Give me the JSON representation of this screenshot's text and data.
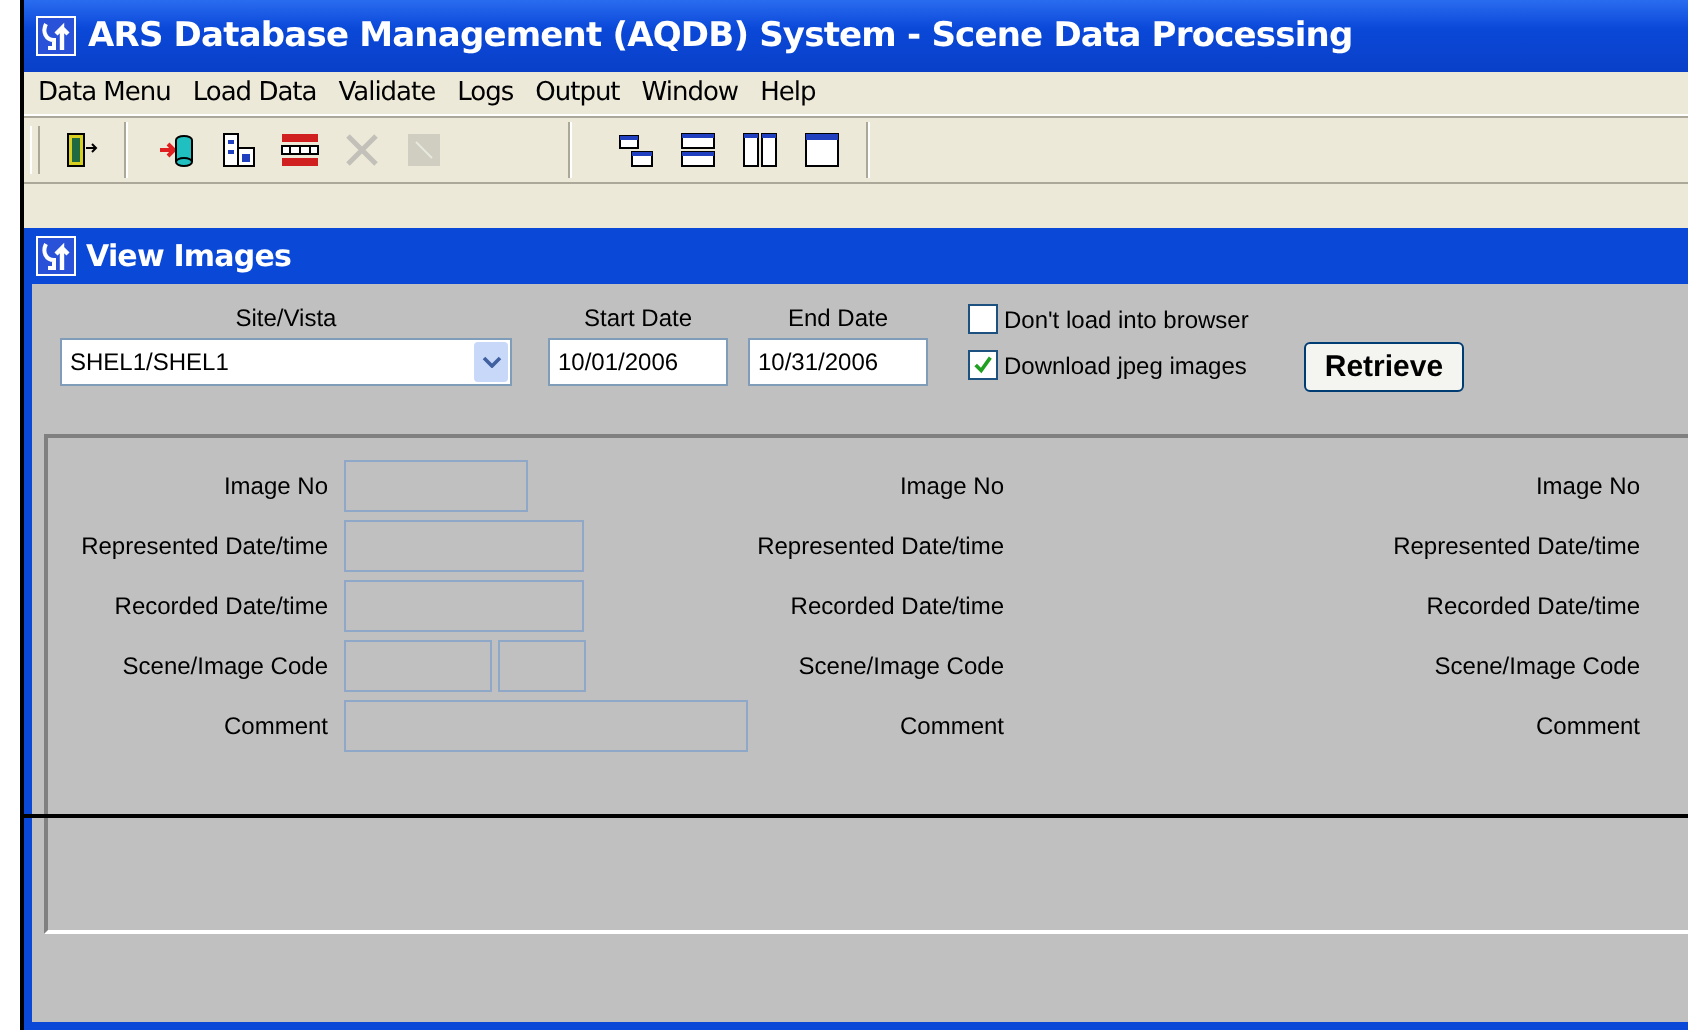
{
  "window": {
    "title": "ARS Database Management (AQDB) System - Scene Data Processing"
  },
  "menu": [
    {
      "label": "Data Menu"
    },
    {
      "label": "Load Data"
    },
    {
      "label": "Validate"
    },
    {
      "label": "Logs"
    },
    {
      "label": "Output"
    },
    {
      "label": "Window"
    },
    {
      "label": "Help"
    }
  ],
  "toolbar": [
    [
      {
        "kind": "exit",
        "disabled": false
      }
    ],
    [
      {
        "kind": "import",
        "disabled": false
      },
      {
        "kind": "building",
        "disabled": false
      },
      {
        "kind": "grid",
        "disabled": false
      },
      {
        "kind": "delete",
        "disabled": true
      },
      {
        "kind": "image",
        "disabled": true
      }
    ],
    [
      {
        "kind": "cascade",
        "disabled": false
      },
      {
        "kind": "tile-horizontal",
        "disabled": false
      },
      {
        "kind": "tile-vertical",
        "disabled": false
      },
      {
        "kind": "maximize",
        "disabled": false
      }
    ]
  ],
  "child_window": {
    "title": "View Images",
    "site_vista": {
      "label": "Site/Vista",
      "value": "SHEL1/SHEL1"
    },
    "start_date": {
      "label": "Start Date",
      "value": "10/01/2006"
    },
    "end_date": {
      "label": "End Date",
      "value": "10/31/2006"
    },
    "options": [
      {
        "label": "Don't load into browser",
        "checked": false
      },
      {
        "label": "Download jpeg images",
        "checked": true
      }
    ],
    "retrieve_button": "Retrieve",
    "record_columns": [
      {
        "fields": [
          {
            "label": "Image No",
            "kind": "short"
          },
          {
            "label": "Represented Date/time",
            "kind": "medium"
          },
          {
            "label": "Recorded Date/time",
            "kind": "medium"
          },
          {
            "label": "Scene/Image Code",
            "kind": "split"
          },
          {
            "label": "Comment",
            "kind": "long"
          }
        ]
      },
      {
        "fields": [
          {
            "label": "Image No"
          },
          {
            "label": "Represented Date/time"
          },
          {
            "label": "Recorded Date/time"
          },
          {
            "label": "Scene/Image Code"
          },
          {
            "label": "Comment"
          }
        ]
      },
      {
        "fields": [
          {
            "label": "Image No"
          },
          {
            "label": "Represented Date/time"
          },
          {
            "label": "Recorded Date/time"
          },
          {
            "label": "Scene/Image Code"
          },
          {
            "label": "Comment"
          }
        ]
      }
    ]
  }
}
